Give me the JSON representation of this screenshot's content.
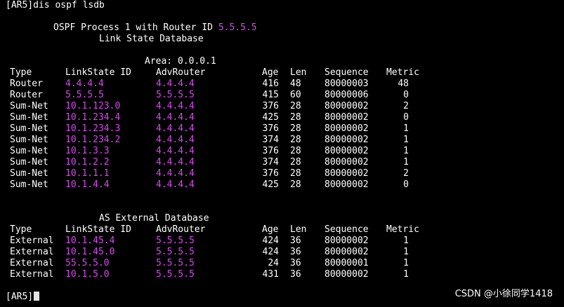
{
  "command_line": "[AR5]dis ospf lsdb",
  "header": {
    "process_prefix": "OSPF Process 1 with Router ID ",
    "router_id": "5.5.5.5",
    "title": "Link State Database"
  },
  "area": {
    "label": "Area: 0.0.0.1",
    "columns": [
      "Type",
      "LinkState ID",
      "AdvRouter",
      "Age",
      "Len",
      "Sequence",
      "Metric"
    ],
    "rows": [
      {
        "type": "Router",
        "lsid": "4.4.4.4",
        "adv": "4.4.4.4",
        "age": "416",
        "len": "48",
        "seq": "80000003",
        "metric": "48"
      },
      {
        "type": "Router",
        "lsid": "5.5.5.5",
        "adv": "5.5.5.5",
        "age": "415",
        "len": "60",
        "seq": "80000006",
        "metric": "0"
      },
      {
        "type": "Sum-Net",
        "lsid": "10.1.123.0",
        "adv": "4.4.4.4",
        "age": "376",
        "len": "28",
        "seq": "80000002",
        "metric": "2"
      },
      {
        "type": "Sum-Net",
        "lsid": "10.1.234.4",
        "adv": "4.4.4.4",
        "age": "425",
        "len": "28",
        "seq": "80000002",
        "metric": "0"
      },
      {
        "type": "Sum-Net",
        "lsid": "10.1.234.3",
        "adv": "4.4.4.4",
        "age": "376",
        "len": "28",
        "seq": "80000002",
        "metric": "1"
      },
      {
        "type": "Sum-Net",
        "lsid": "10.1.234.2",
        "adv": "4.4.4.4",
        "age": "374",
        "len": "28",
        "seq": "80000002",
        "metric": "1"
      },
      {
        "type": "Sum-Net",
        "lsid": "10.1.3.3",
        "adv": "4.4.4.4",
        "age": "376",
        "len": "28",
        "seq": "80000002",
        "metric": "1"
      },
      {
        "type": "Sum-Net",
        "lsid": "10.1.2.2",
        "adv": "4.4.4.4",
        "age": "374",
        "len": "28",
        "seq": "80000002",
        "metric": "1"
      },
      {
        "type": "Sum-Net",
        "lsid": "10.1.1.1",
        "adv": "4.4.4.4",
        "age": "376",
        "len": "28",
        "seq": "80000002",
        "metric": "2"
      },
      {
        "type": "Sum-Net",
        "lsid": "10.1.4.4",
        "adv": "4.4.4.4",
        "age": "425",
        "len": "28",
        "seq": "80000002",
        "metric": "0"
      }
    ]
  },
  "external": {
    "label": "AS External Database",
    "columns": [
      "Type",
      "LinkState ID",
      "AdvRouter",
      "Age",
      "Len",
      "Sequence",
      "Metric"
    ],
    "rows": [
      {
        "type": "External",
        "lsid": "10.1.45.4",
        "adv": "5.5.5.5",
        "age": "424",
        "len": "36",
        "seq": "80000002",
        "metric": "1"
      },
      {
        "type": "External",
        "lsid": "10.1.45.0",
        "adv": "5.5.5.5",
        "age": "424",
        "len": "36",
        "seq": "80000002",
        "metric": "1"
      },
      {
        "type": "External",
        "lsid": "55.5.5.0",
        "adv": "5.5.5.5",
        "age": "24",
        "len": "36",
        "seq": "80000001",
        "metric": "1"
      },
      {
        "type": "External",
        "lsid": "10.1.5.0",
        "adv": "5.5.5.5",
        "age": "431",
        "len": "36",
        "seq": "80000002",
        "metric": "1"
      }
    ]
  },
  "prompt": "[AR5]",
  "watermark": "CSDN @小徐同学1418",
  "colors": {
    "background": "#000000",
    "text": "#ffffff",
    "highlight": "#d946ef"
  }
}
